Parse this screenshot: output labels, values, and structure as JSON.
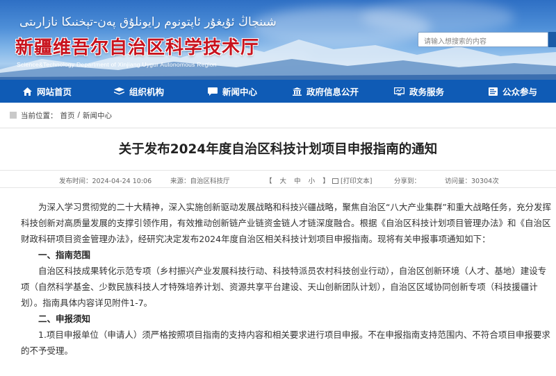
{
  "banner": {
    "uyghur_title": "شىنجاڭ ئۇيغۇر ئاپتونوم رايونلۇق پەن-تېخنىكا نازارىتى",
    "cn_title": "新疆维吾尔自治区科学技术厅",
    "en_title": "Science&Technology Department of Xinjiang Uygur Autonomous Region"
  },
  "search": {
    "placeholder": "请输入想搜索的内容"
  },
  "nav": {
    "items": [
      {
        "label": "网站首页",
        "icon": "home-icon"
      },
      {
        "label": "组织机构",
        "icon": "layers-icon"
      },
      {
        "label": "新闻中心",
        "icon": "chat-icon"
      },
      {
        "label": "政府信息公开",
        "icon": "building-icon"
      },
      {
        "label": "政务服务",
        "icon": "monitor-icon"
      },
      {
        "label": "公众参与",
        "icon": "forum-icon"
      }
    ]
  },
  "breadcrumb": {
    "prefix": "当前位置：",
    "home": "首页",
    "sep": "/",
    "current": "新闻中心"
  },
  "article": {
    "title": "关于发布2024年度自治区科技计划项目申报指南的通知",
    "meta": {
      "date": "发布时间：2024-04-24 10:06",
      "source": "来源：自治区科技厅",
      "size_open": "【",
      "size_large": "大",
      "size_medium": "中",
      "size_small": "小",
      "size_close": "】",
      "print": "[打印文本]",
      "share": "分享到：",
      "views": "访问量：30304次"
    },
    "paragraph1": "为深入学习贯彻党的二十大精神，深入实施创新驱动发展战略和科技兴疆战略，聚焦自治区“八大产业集群”和重大战略任务，充分发挥科技创新对高质量发展的支撑引领作用，有效推动创新链产业链资金链人才链深度融合。根据《自治区科技计划项目管理办法》和《自治区财政科研项目资金管理办法》，经研究决定发布2024年度自治区相关科技计划项目申报指南。现将有关申报事项通知如下：",
    "section1": "一、指南范围",
    "paragraph2": "自治区科技成果转化示范专项（乡村振兴产业发展科技行动、科技特派员农村科技创业行动），自治区创新环境（人才、基地）建设专项（自然科学基金、少数民族科技人才特殊培养计划、资源共享平台建设、天山创新团队计划），自治区区域协同创新专项（科技援疆计划）。指南具体内容详见附件1-7。",
    "section2": "二、申报须知",
    "paragraph3": "1.项目申报单位（申请人）须严格按照项目指南的支持内容和相关要求进行项目申报。不在申报指南支持范围内、不符合项目申报要求的不予受理。"
  },
  "colors": {
    "nav_bg": "#0f5bb5",
    "title_red": "#c8121d"
  }
}
